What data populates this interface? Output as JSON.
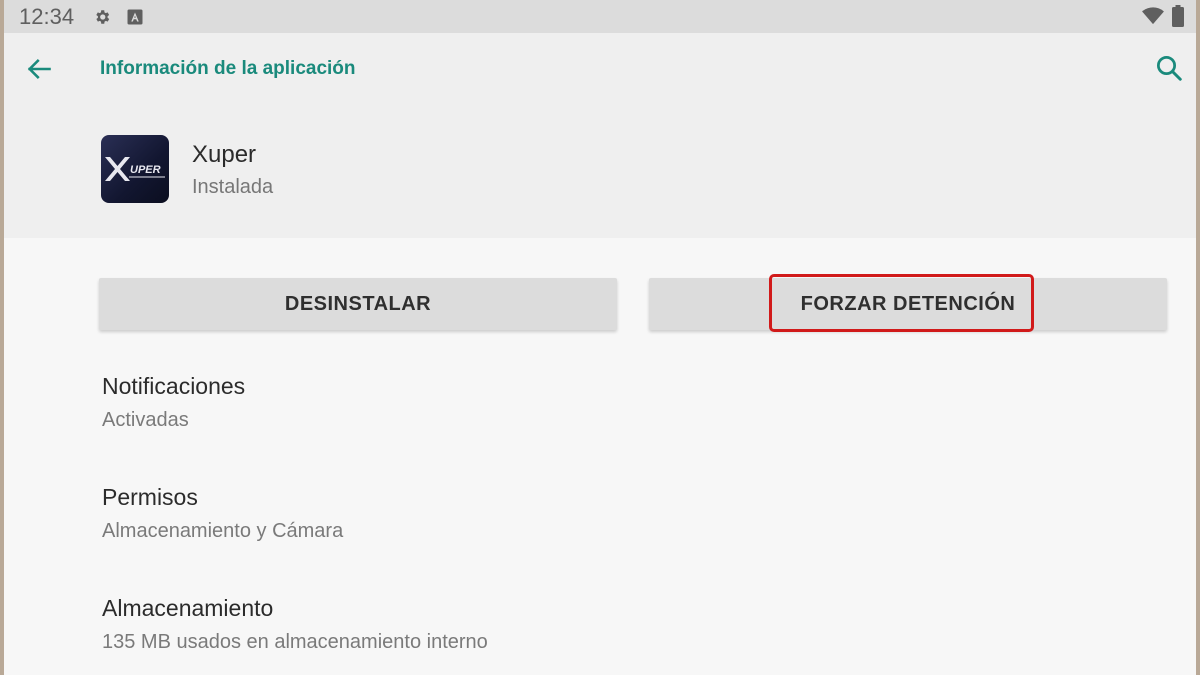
{
  "status_bar": {
    "time": "12:34",
    "icons": [
      "gear-icon",
      "a-square-icon",
      "wifi-icon",
      "battery-icon"
    ]
  },
  "header": {
    "title": "Información de la aplicación",
    "back_icon": "arrow-left-icon",
    "search_icon": "search-icon",
    "accent_color": "#1a8a7c"
  },
  "app": {
    "name": "Xuper",
    "status": "Instalada",
    "icon_text": "UPER"
  },
  "buttons": {
    "uninstall_label": "DESINSTALAR",
    "force_stop_label": "FORZAR DETENCIÓN",
    "highlight_color": "#d11a1a"
  },
  "settings": [
    {
      "title": "Notificaciones",
      "subtitle": "Activadas"
    },
    {
      "title": "Permisos",
      "subtitle": "Almacenamiento y Cámara"
    },
    {
      "title": "Almacenamiento",
      "subtitle": "135 MB usados en almacenamiento interno"
    }
  ]
}
